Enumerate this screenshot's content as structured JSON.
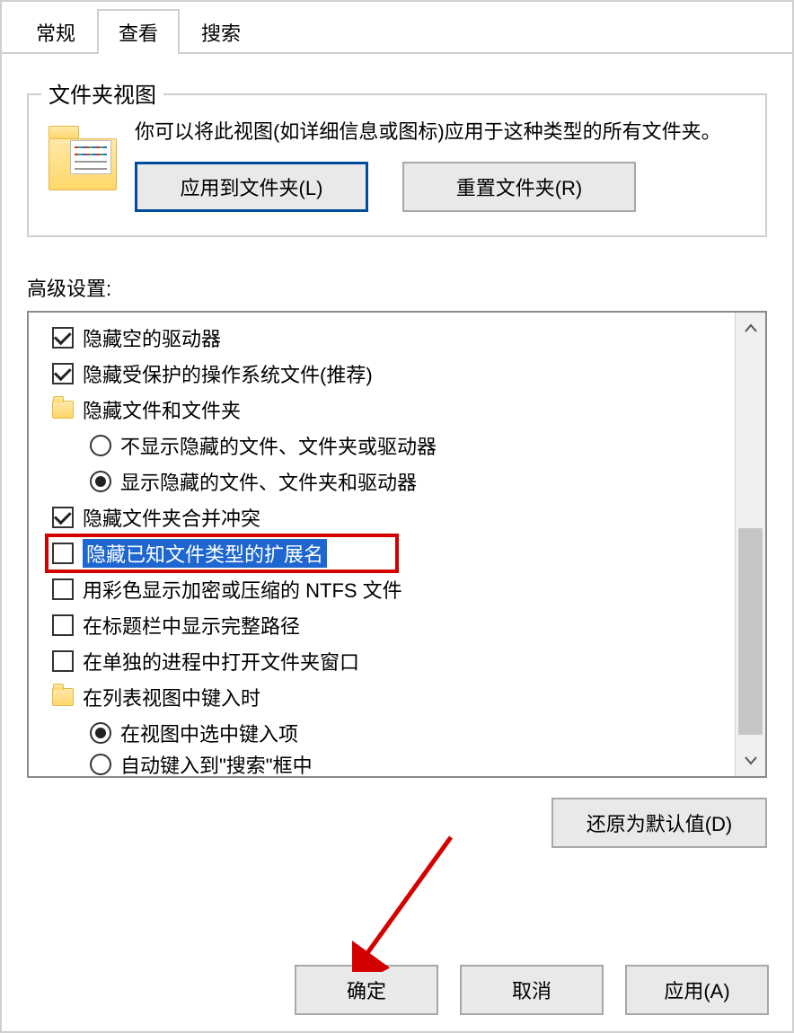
{
  "tabs": {
    "general": "常规",
    "view": "查看",
    "search": "搜索"
  },
  "folderView": {
    "title": "文件夹视图",
    "desc": "你可以将此视图(如详细信息或图标)应用于这种类型的所有文件夹。",
    "applyBtn": "应用到文件夹(L)",
    "resetBtn": "重置文件夹(R)"
  },
  "advanced": {
    "label": "高级设置:",
    "items": [
      {
        "kind": "checkbox",
        "checked": true,
        "indent": 0,
        "label": "隐藏空的驱动器"
      },
      {
        "kind": "checkbox",
        "checked": true,
        "indent": 0,
        "label": "隐藏受保护的操作系统文件(推荐)"
      },
      {
        "kind": "folder",
        "indent": 0,
        "label": "隐藏文件和文件夹"
      },
      {
        "kind": "radio",
        "selected": false,
        "indent": 1,
        "label": "不显示隐藏的文件、文件夹或驱动器"
      },
      {
        "kind": "radio",
        "selected": true,
        "indent": 1,
        "label": "显示隐藏的文件、文件夹和驱动器"
      },
      {
        "kind": "checkbox",
        "checked": true,
        "indent": 0,
        "label": "隐藏文件夹合并冲突"
      },
      {
        "kind": "checkbox",
        "checked": false,
        "indent": 0,
        "label": "隐藏已知文件类型的扩展名",
        "highlight": true,
        "redbox": true
      },
      {
        "kind": "checkbox",
        "checked": false,
        "indent": 0,
        "label": "用彩色显示加密或压缩的 NTFS 文件"
      },
      {
        "kind": "checkbox",
        "checked": false,
        "indent": 0,
        "label": "在标题栏中显示完整路径"
      },
      {
        "kind": "checkbox",
        "checked": false,
        "indent": 0,
        "label": "在单独的进程中打开文件夹窗口"
      },
      {
        "kind": "folder",
        "indent": 0,
        "label": "在列表视图中键入时"
      },
      {
        "kind": "radio",
        "selected": true,
        "indent": 1,
        "label": "在视图中选中键入项"
      },
      {
        "kind": "radio",
        "selected": false,
        "indent": 1,
        "label": "自动键入到\"搜索\"框中",
        "cut": true
      }
    ],
    "restoreBtn": "还原为默认值(D)"
  },
  "buttons": {
    "ok": "确定",
    "cancel": "取消",
    "apply": "应用(A)"
  }
}
